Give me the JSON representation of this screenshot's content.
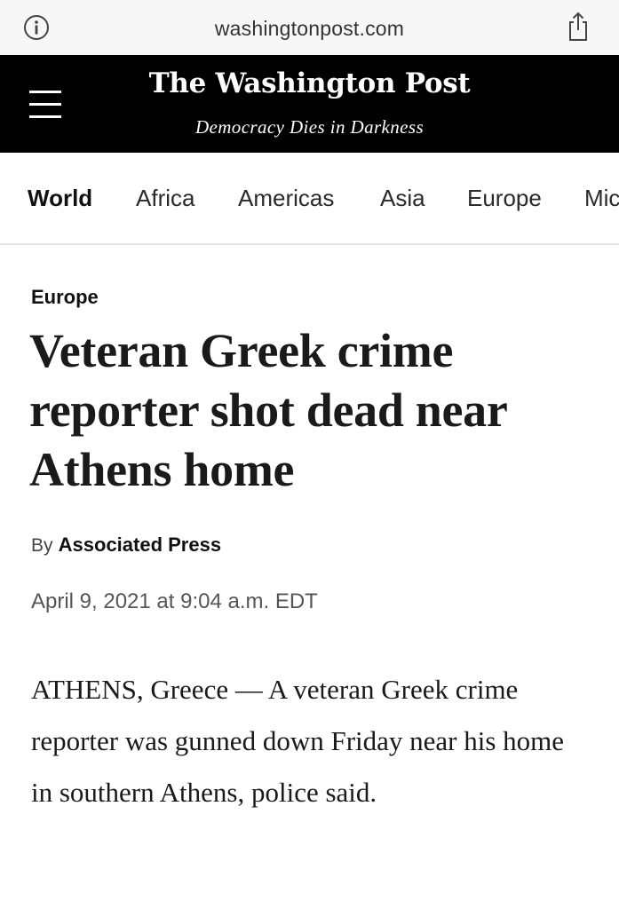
{
  "browser": {
    "url": "washingtonpost.com",
    "info_icon": "info-icon",
    "share_icon": "share-icon"
  },
  "masthead": {
    "logo_text": "The Washington Post",
    "tagline": "Democracy Dies in Darkness",
    "menu_icon": "hamburger-menu-icon",
    "background": "#000000"
  },
  "nav": {
    "items": [
      {
        "label": "World",
        "active": true
      },
      {
        "label": "Africa"
      },
      {
        "label": "Americas"
      },
      {
        "label": "Asia"
      },
      {
        "label": "Europe"
      },
      {
        "label": "Mic"
      }
    ]
  },
  "article": {
    "kicker": "Europe",
    "headline": "Veteran Greek crime reporter shot dead near Athens home",
    "byline_prefix": "By",
    "author": "Associated Press",
    "date": "April 9, 2021 at 9:04 a.m. EDT",
    "body": "ATHENS, Greece — A veteran Greek crime reporter was gunned down Friday near his home in southern Athens, police said."
  }
}
